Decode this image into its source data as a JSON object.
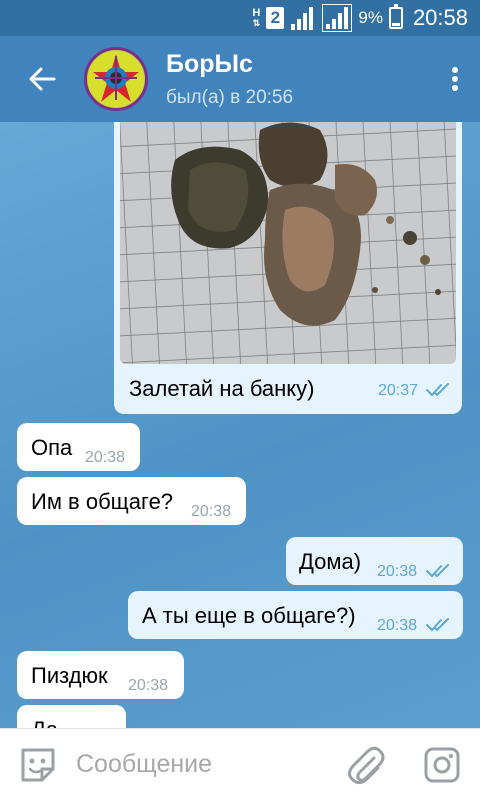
{
  "status_bar": {
    "network_letter": "H",
    "sim_number": "2",
    "battery_percent": "9%",
    "time": "20:58"
  },
  "header": {
    "contact_name": "БорЫс",
    "last_seen": "был(а) в 20:56",
    "back_icon": "arrow-left-icon",
    "menu_icon": "more-vertical-icon"
  },
  "messages": [
    {
      "type": "photo",
      "direction": "outgoing",
      "caption": "Залетай на банку)",
      "time": "20:37",
      "read": true
    },
    {
      "direction": "incoming",
      "text": "Опа",
      "time": "20:38"
    },
    {
      "direction": "incoming",
      "text": "Им в общаге?",
      "time": "20:38"
    },
    {
      "direction": "outgoing",
      "text": "Дома)",
      "time": "20:38",
      "read": true
    },
    {
      "direction": "outgoing",
      "text": "А ты еще в общаге?)",
      "time": "20:38",
      "read": true
    },
    {
      "direction": "incoming",
      "text": "Пиздюк",
      "time": "20:38"
    },
    {
      "direction": "incoming",
      "text": "Да",
      "time": ""
    }
  ],
  "composer": {
    "placeholder": "Сообщение",
    "emoji_icon": "sticker-icon",
    "attach_icon": "paperclip-icon",
    "camera_icon": "instagram-camera-icon"
  },
  "colors": {
    "header": "#4083bd",
    "status_bar": "#326fa3",
    "chat_background": "#5a9bc9",
    "outgoing_bubble": "#e6f4ff",
    "incoming_bubble": "#ffffff",
    "read_checks": "#5ea8d8"
  }
}
